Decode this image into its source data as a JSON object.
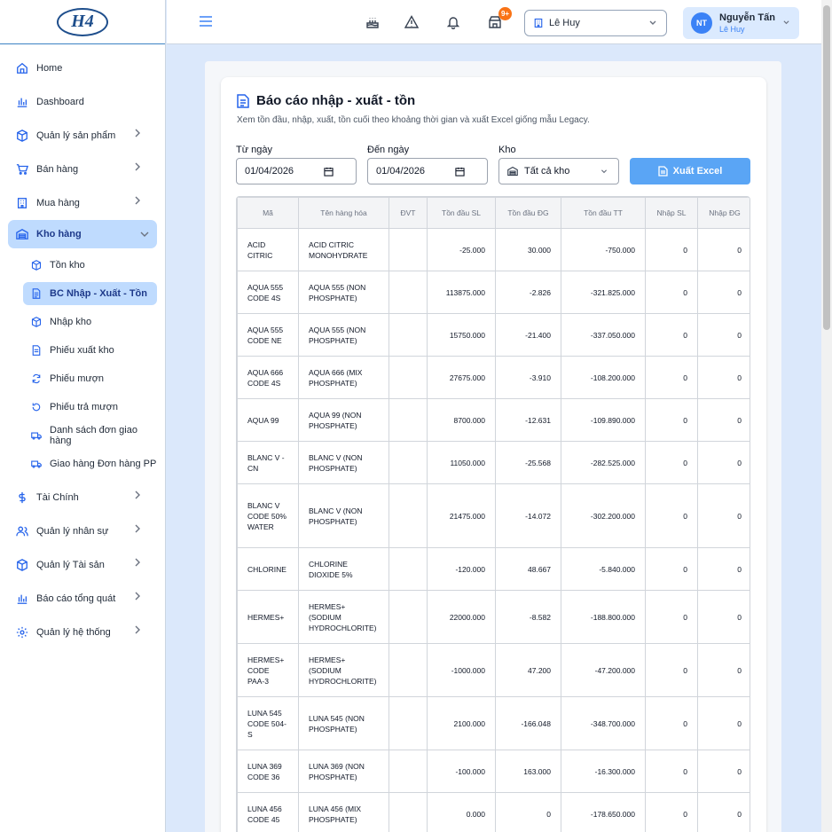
{
  "brand": {
    "logo_text": "H4"
  },
  "sidebar": {
    "items": [
      {
        "label": "Home"
      },
      {
        "label": "Dashboard"
      },
      {
        "label": "Quản lý sản phẩm"
      },
      {
        "label": "Bán hàng"
      },
      {
        "label": "Mua hàng"
      },
      {
        "label": "Kho hàng"
      },
      {
        "label": "Tài Chính"
      },
      {
        "label": "Quản lý nhân sự"
      },
      {
        "label": "Quản lý Tài sản"
      },
      {
        "label": "Báo cáo tổng quát"
      },
      {
        "label": "Quản lý hệ thống"
      }
    ],
    "sub_items": [
      {
        "label": "Tồn kho"
      },
      {
        "label": "BC Nhập - Xuất - Tồn"
      },
      {
        "label": "Nhập kho"
      },
      {
        "label": "Phiếu xuất kho"
      },
      {
        "label": "Phiếu mượn"
      },
      {
        "label": "Phiếu trả mượn"
      },
      {
        "label": "Danh sách đơn giao hàng"
      },
      {
        "label": "Giao hàng Đơn hàng PP"
      }
    ]
  },
  "topbar": {
    "notification_badge": "9+",
    "branch": "Lê Huy",
    "user": {
      "initials": "NT",
      "name": "Nguyễn Tấn",
      "branch": "Lê Huy"
    }
  },
  "report": {
    "title": "Báo cáo nhập - xuất - tồn",
    "subtitle": "Xem tồn đầu, nhập, xuất, tồn cuối theo khoảng thời gian và xuất Excel giống mẫu Legacy.",
    "from_label": "Từ ngày",
    "from_value": "01/04/2026",
    "to_label": "Đến ngày",
    "to_value": "01/04/2026",
    "kho_label": "Kho",
    "kho_value": "Tất cả kho",
    "export_label": "Xuất Excel",
    "columns": [
      "Mã",
      "Tên hàng hóa",
      "ĐVT",
      "Tồn đầu SL",
      "Tồn đầu ĐG",
      "Tồn đầu TT",
      "Nhập SL",
      "Nhập ĐG"
    ],
    "rows": [
      {
        "ma": "ACID CITRIC",
        "ten": "ACID CITRIC MONOHYDRATE",
        "dvt": "",
        "sl": "-25.000",
        "dg": "30.000",
        "tt": "-750.000",
        "nsl": "0",
        "ndg": "0"
      },
      {
        "ma": "AQUA 555 CODE 4S",
        "ten": "AQUA 555 (NON PHOSPHATE)",
        "dvt": "",
        "sl": "113875.000",
        "dg": "-2.826",
        "tt": "-321.825.000",
        "nsl": "0",
        "ndg": "0"
      },
      {
        "ma": "AQUA 555 CODE NE",
        "ten": "AQUA 555 (NON PHOSPHATE)",
        "dvt": "",
        "sl": "15750.000",
        "dg": "-21.400",
        "tt": "-337.050.000",
        "nsl": "0",
        "ndg": "0"
      },
      {
        "ma": "AQUA 666 CODE 4S",
        "ten": "AQUA 666 (MIX PHOSPHATE)",
        "dvt": "",
        "sl": "27675.000",
        "dg": "-3.910",
        "tt": "-108.200.000",
        "nsl": "0",
        "ndg": "0"
      },
      {
        "ma": "AQUA 99",
        "ten": "AQUA 99 (NON PHOSPHATE)",
        "dvt": "",
        "sl": "8700.000",
        "dg": "-12.631",
        "tt": "-109.890.000",
        "nsl": "0",
        "ndg": "0"
      },
      {
        "ma": "BLANC V - CN",
        "ten": "BLANC V (NON PHOSPHATE)",
        "dvt": "",
        "sl": "11050.000",
        "dg": "-25.568",
        "tt": "-282.525.000",
        "nsl": "0",
        "ndg": "0"
      },
      {
        "ma": "BLANC V CODE 50% WATER",
        "ten": "BLANC V (NON PHOSPHATE)",
        "dvt": "",
        "sl": "21475.000",
        "dg": "-14.072",
        "tt": "-302.200.000",
        "nsl": "0",
        "ndg": "0"
      },
      {
        "ma": "CHLORINE",
        "ten": "CHLORINE DIOXIDE 5%",
        "dvt": "",
        "sl": "-120.000",
        "dg": "48.667",
        "tt": "-5.840.000",
        "nsl": "0",
        "ndg": "0"
      },
      {
        "ma": "HERMES+",
        "ten": "HERMES+ (SODIUM HYDROCHLORITE)",
        "dvt": "",
        "sl": "22000.000",
        "dg": "-8.582",
        "tt": "-188.800.000",
        "nsl": "0",
        "ndg": "0"
      },
      {
        "ma": "HERMES+ CODE PAA-3",
        "ten": "HERMES+ (SODIUM HYDROCHLORITE)",
        "dvt": "",
        "sl": "-1000.000",
        "dg": "47.200",
        "tt": "-47.200.000",
        "nsl": "0",
        "ndg": "0"
      },
      {
        "ma": "LUNA 545 CODE 504-S",
        "ten": "LUNA 545 (NON PHOSPHATE)",
        "dvt": "",
        "sl": "2100.000",
        "dg": "-166.048",
        "tt": "-348.700.000",
        "nsl": "0",
        "ndg": "0"
      },
      {
        "ma": "LUNA 369 CODE 36",
        "ten": "LUNA 369 (NON PHOSPHATE)",
        "dvt": "",
        "sl": "-100.000",
        "dg": "163.000",
        "tt": "-16.300.000",
        "nsl": "0",
        "ndg": "0"
      },
      {
        "ma": "LUNA 456 CODE 45",
        "ten": "LUNA 456 (MIX PHOSPHATE)",
        "dvt": "",
        "sl": "0.000",
        "dg": "0",
        "tt": "-178.650.000",
        "nsl": "0",
        "ndg": "0"
      }
    ]
  }
}
